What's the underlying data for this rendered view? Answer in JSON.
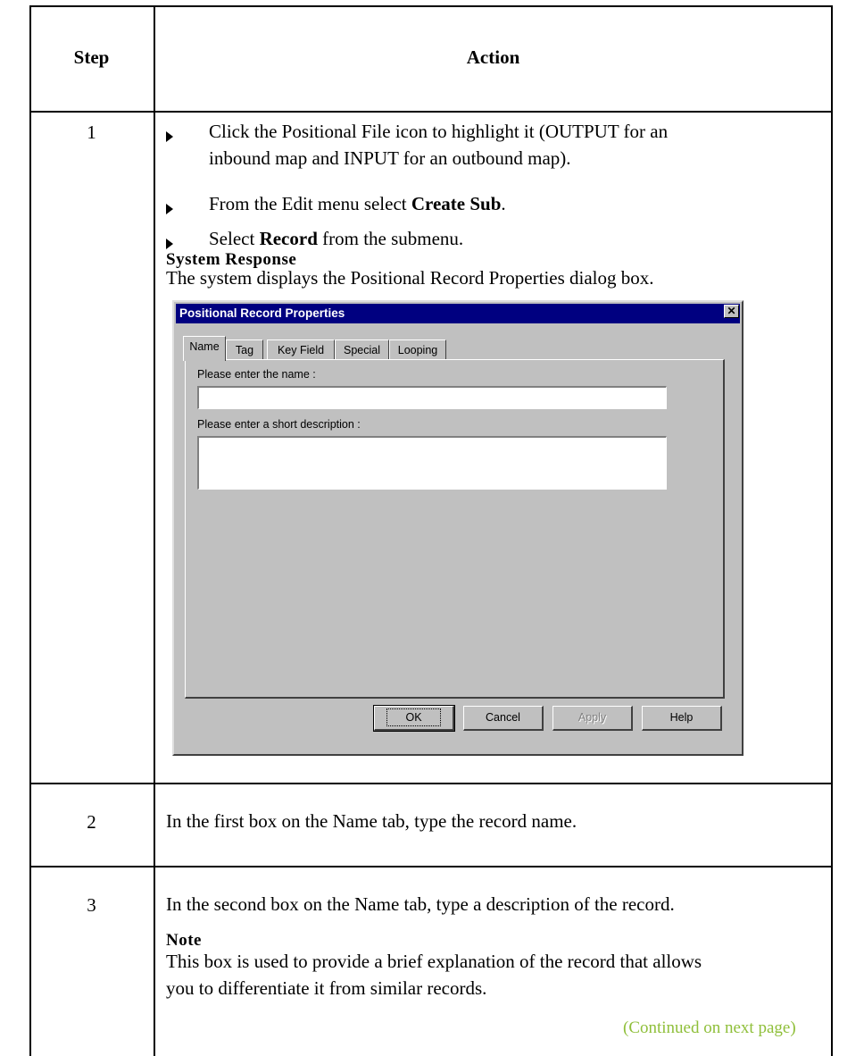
{
  "table": {
    "header": {
      "step": "Step",
      "action": "Action"
    },
    "rows": [
      {
        "step": "1",
        "bullets": [
          {
            "line1": "Click the Positional File icon to highlight it (OUTPUT for an",
            "line2": "inbound map and INPUT for an outbound map)."
          },
          {
            "pre": "From the Edit menu select ",
            "bold": "Create Sub",
            "post": "."
          },
          {
            "pre": "Select ",
            "bold": "Record",
            "post": " from the submenu."
          }
        ],
        "system_response_heading": "System Response",
        "system_response_text": "The system displays the Positional Record Properties dialog box."
      },
      {
        "step": "2",
        "text": "In the first box on the Name tab, type the record name."
      },
      {
        "step": "3",
        "text": "In the second box on the Name tab, type a description of the record.",
        "note_heading": "Note",
        "note_line1": "This box is used to provide a brief explanation of the record that allows",
        "note_line2": "you to differentiate it from similar records.",
        "continued": "(Continued on next page)"
      }
    ]
  },
  "dialog": {
    "title": "Positional Record Properties",
    "close_icon": "close-icon",
    "tabs": [
      "Name",
      "Tag",
      "Key Field",
      "Special",
      "Looping"
    ],
    "active_tab": "Name",
    "name_label": "Please enter the name :",
    "name_value": "",
    "description_label": "Please enter a short description :",
    "description_value": "",
    "buttons": {
      "ok": "OK",
      "cancel": "Cancel",
      "apply": "Apply",
      "help": "Help"
    }
  }
}
